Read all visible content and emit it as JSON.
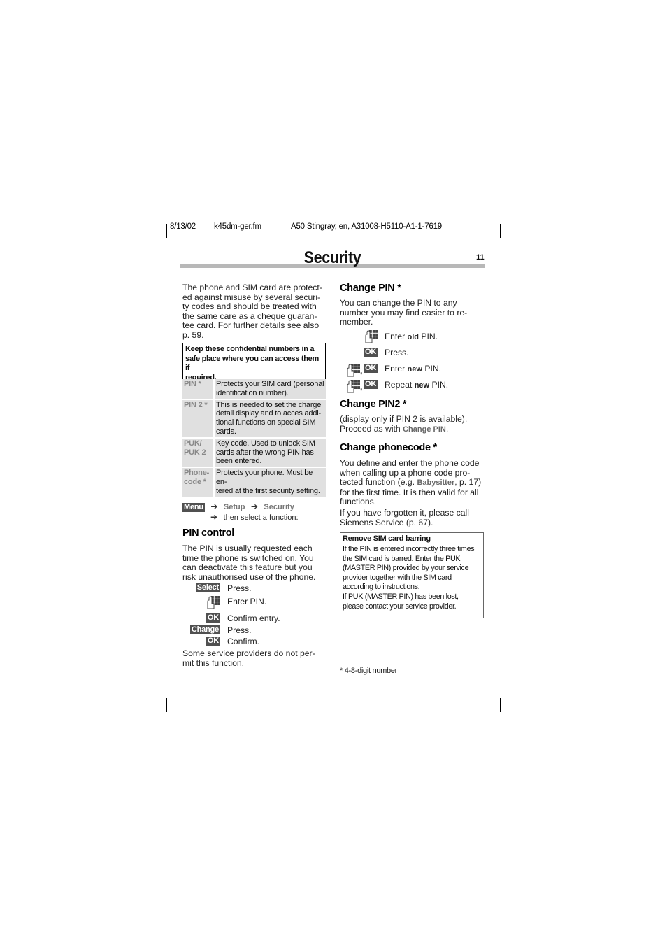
{
  "header": {
    "date": "8/13/02",
    "file": "k45dm-ger.fm",
    "product": "A50 Stingray, en, A31008-H5110-A1-1-7619"
  },
  "page": {
    "title": "Security",
    "number": "11"
  },
  "intro": {
    "text": "The phone and SIM card are protected against misuse by several security codes and should be treated with the same care as a cheque guarantee card. For further details see also p. 59.",
    "lines": [
      "The phone and SIM card are protect-",
      "ed against misuse by several securi-",
      "ty codes and should be treated with",
      "the same care as a cheque guaran-",
      "tee card. For further details see also",
      "p. 59."
    ]
  },
  "confidential_note": {
    "lines": [
      "Keep these confidential numbers in a",
      "safe place where you can access them if",
      "required."
    ]
  },
  "codes_table": [
    {
      "key_lines": [
        "PIN *"
      ],
      "desc_lines": [
        "Protects your SIM card (personal",
        "identification number)."
      ]
    },
    {
      "key_lines": [
        "PIN 2 *"
      ],
      "desc_lines": [
        "This is needed to set the charge",
        "detail display and to acces addi-",
        "tional functions on special SIM",
        "cards."
      ]
    },
    {
      "key_lines": [
        "PUK/",
        "PUK 2"
      ],
      "desc_lines": [
        "Key code. Used to unlock SIM",
        "cards after the wrong PIN has",
        "been entered."
      ]
    },
    {
      "key_lines": [
        "Phone-",
        "code *"
      ],
      "desc_lines": [
        "Protects your phone. Must be en-",
        "tered at the first security setting."
      ]
    }
  ],
  "menu_path": {
    "softkey": "Menu",
    "items": [
      "Setup",
      "Security"
    ],
    "instruction": "then select a function:",
    "arrow_icon": "arrow-right-icon"
  },
  "pin_control": {
    "heading": "PIN control",
    "lines": [
      "The PIN is usually requested each",
      "time the phone is switched on. You",
      "can deactivate this feature but you",
      "risk unauthorised use of the phone."
    ],
    "steps": [
      {
        "icon": "softkey",
        "key": "Select",
        "text": "Press."
      },
      {
        "icon": "keypad-icon",
        "key": "",
        "text": "Enter PIN."
      },
      {
        "icon": "softkey",
        "key": "OK",
        "text": "Confirm entry."
      },
      {
        "icon": "softkey",
        "key": "Change",
        "text": "Press."
      },
      {
        "icon": "softkey",
        "key": "OK",
        "text": "Confirm."
      }
    ],
    "footer_lines": [
      "Some service providers do not per-",
      "mit this function."
    ]
  },
  "change_pin": {
    "heading": "Change PIN *",
    "lines": [
      "You can change the PIN to any",
      "number you may find easier to re-",
      "member."
    ],
    "steps": [
      {
        "icons": "keypad",
        "pre": "Enter ",
        "bold": "old",
        "post": " PIN."
      },
      {
        "icons": "ok",
        "pre": "Press.",
        "bold": "",
        "post": ""
      },
      {
        "icons": "keypad-ok",
        "pre": "Enter ",
        "bold": "new",
        "post": " PIN."
      },
      {
        "icons": "keypad-ok",
        "pre": "Repeat ",
        "bold": "new",
        "post": " PIN."
      }
    ],
    "ok_label": "OK",
    "separator": ","
  },
  "change_pin2": {
    "heading": "Change PIN2 *",
    "line1": "(display only if PIN 2 is available).",
    "line2_pre": "Proceed as with ",
    "line2_ref": "Change PIN",
    "line2_post": "."
  },
  "change_phonecode": {
    "heading": "Change phonecode *",
    "para1": {
      "line1": "You define and enter the phone code",
      "line2": "when calling up a phone code pro-",
      "line3_pre": "tected function (e.g. ",
      "line3_ref": "Babysitter",
      "line3_post": ", p. 17)",
      "line4": "for the first time. It is then valid for all",
      "line5": "functions."
    },
    "para2_lines": [
      "If you have forgotten it, please call",
      "Siemens Service (p. 67)."
    ]
  },
  "sim_barring": {
    "title": "Remove SIM card barring",
    "lines": [
      "If the PIN is entered incorrectly three times",
      "the SIM card is barred. Enter the PUK",
      "(MASTER PIN) provided by your service",
      "provider together with the SIM card",
      "according to instructions.",
      "If PUK (MASTER PIN) has been lost,",
      "please contact your service provider."
    ]
  },
  "footnote": "* 4-8-digit number",
  "colors": {
    "softkey_bg": "#505050",
    "table_bg": "#e0e0e0",
    "title_bar": "#b8b8b8",
    "menu_ref": "#777777"
  }
}
